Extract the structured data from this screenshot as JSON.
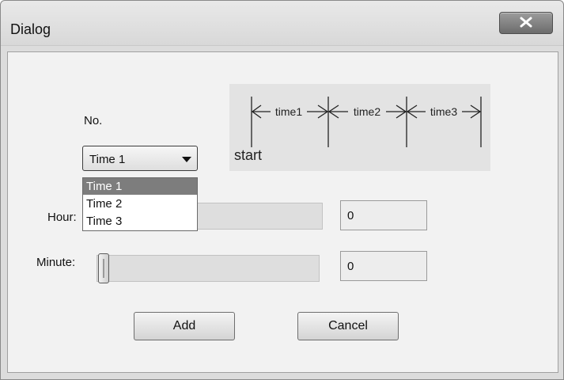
{
  "window": {
    "title": "Dialog"
  },
  "no_label": "No.",
  "combo": {
    "selected": "Time 1",
    "options": [
      "Time 1",
      "Time 2",
      "Time 3"
    ],
    "highlighted_index": 0
  },
  "diagram": {
    "segments": [
      "time1",
      "time2",
      "time3"
    ],
    "start_label": "start"
  },
  "hour": {
    "label": "Hour:",
    "value": "0"
  },
  "minute": {
    "label": "Minute:",
    "value": "0"
  },
  "buttons": {
    "add": "Add",
    "cancel": "Cancel"
  },
  "icons": {
    "close": "close-icon",
    "dropdown": "chevron-down-icon"
  }
}
